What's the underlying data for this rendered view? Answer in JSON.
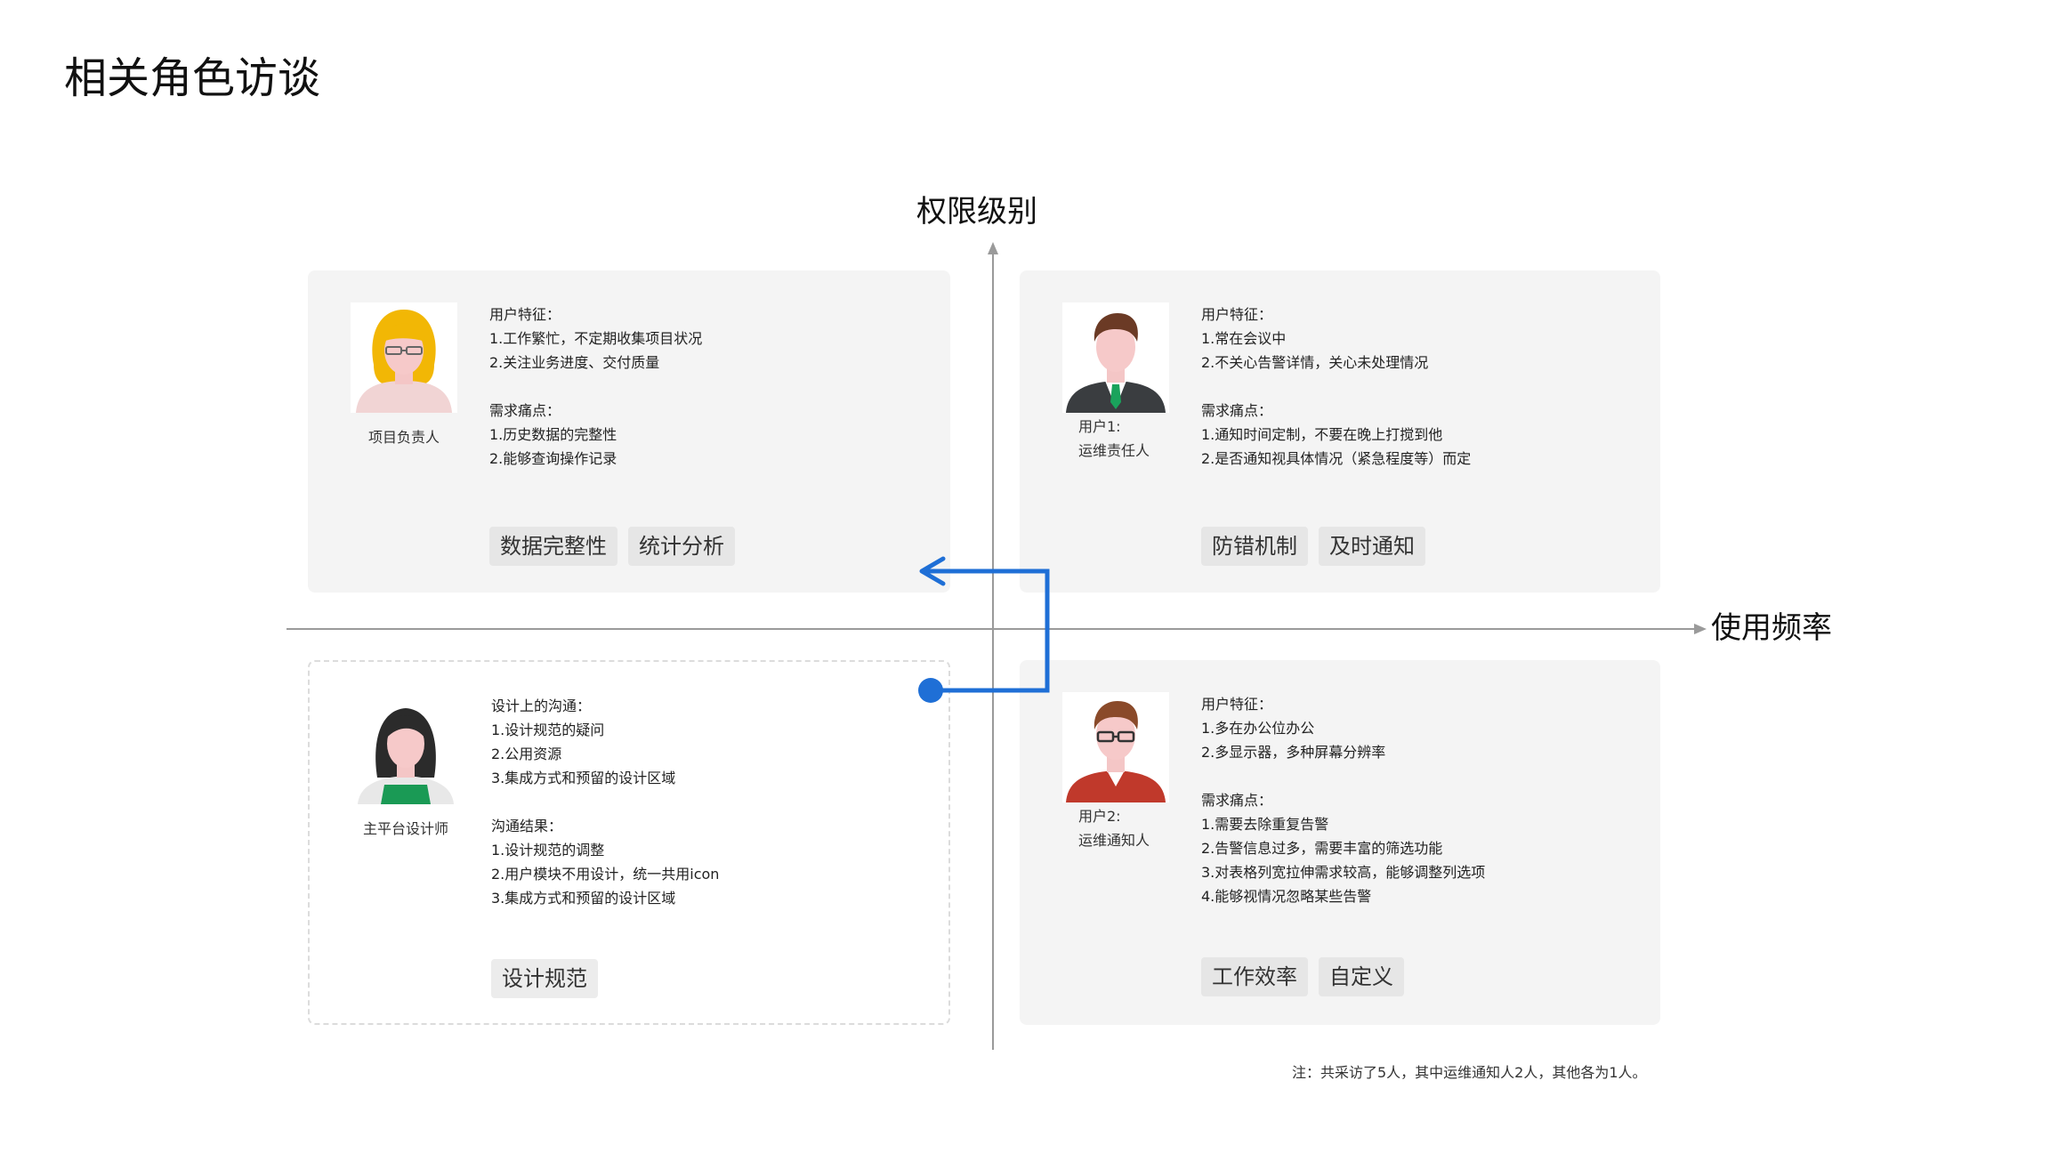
{
  "page_title": "相关角色访谈",
  "axes": {
    "y_label": "权限级别",
    "x_label": "使用频率"
  },
  "colors": {
    "card_bg": "#f4f4f4",
    "tag_bg": "#e6e6e6",
    "flow_arrow": "#1f6fd6",
    "axis": "#9a9a9a"
  },
  "quadrants": [
    {
      "role": "项目负责人",
      "avatar_icon": "woman-blonde-avatar-icon",
      "lines": [
        "用户特征：",
        "1.工作繁忙，不定期收集项目状况",
        "2.关注业务进度、交付质量",
        "",
        "需求痛点：",
        "1.历史数据的完整性",
        "2.能够查询操作记录"
      ],
      "tags": [
        "数据完整性",
        "统计分析"
      ]
    },
    {
      "role_lines": [
        "用户1:",
        "运维责任人"
      ],
      "avatar_icon": "man-suit-avatar-icon",
      "lines": [
        "用户特征：",
        "1.常在会议中",
        "2.不关心告警详情，关心未处理情况",
        "",
        "需求痛点：",
        "1.通知时间定制，不要在晚上打搅到他",
        "2.是否通知视具体情况（紧急程度等）而定"
      ],
      "tags": [
        "防错机制",
        "及时通知"
      ]
    },
    {
      "role": "主平台设计师",
      "avatar_icon": "woman-designer-avatar-icon",
      "lines": [
        "设计上的沟通：",
        "1.设计规范的疑问",
        "2.公用资源",
        "3.集成方式和预留的设计区域",
        "",
        "沟通结果：",
        "1.设计规范的调整",
        "2.用户模块不用设计，统一共用icon",
        "3.集成方式和预留的设计区域"
      ],
      "tags": [
        "设计规范"
      ]
    },
    {
      "role_lines": [
        "用户2:",
        "运维通知人"
      ],
      "avatar_icon": "man-glasses-avatar-icon",
      "lines": [
        "用户特征：",
        "1.多在办公位办公",
        "2.多显示器，多种屏幕分辨率",
        "",
        "需求痛点：",
        "1.需要去除重复告警",
        "2.告警信息过多，需要丰富的筛选功能",
        "3.对表格列宽拉伸需求较高，能够调整列选项",
        "4.能够视情况忽略某些告警"
      ],
      "tags": [
        "工作效率",
        "自定义"
      ]
    }
  ],
  "footnote": "注：共采访了5人，其中运维通知人2人，其他各为1人。"
}
